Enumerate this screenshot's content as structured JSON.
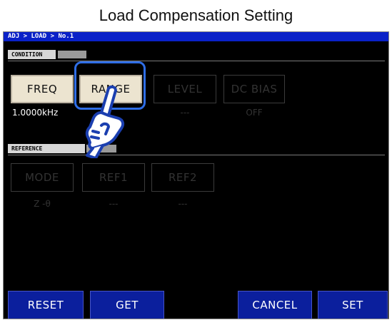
{
  "title": "Load Compensation Setting",
  "breadcrumb": "ADJ > LOAD > No.1",
  "condition": {
    "section_label": "CONDITION",
    "buttons": [
      {
        "label": "FREQ",
        "value": "1.0000kHz",
        "enabled": true
      },
      {
        "label": "RANGE",
        "value": "",
        "enabled": true,
        "highlighted": true
      },
      {
        "label": "LEVEL",
        "value": "---",
        "enabled": false
      },
      {
        "label": "DC BIAS",
        "value": "OFF",
        "enabled": false
      }
    ]
  },
  "reference": {
    "section_label": "REFERENCE",
    "buttons": [
      {
        "label": "MODE",
        "value": "Z -θ",
        "enabled": false
      },
      {
        "label": "REF1",
        "value": "---",
        "enabled": false
      },
      {
        "label": "REF2",
        "value": "---",
        "enabled": false
      }
    ]
  },
  "footer": {
    "reset_label": "RESET",
    "get_label": "GET",
    "cancel_label": "CANCEL",
    "set_label": "SET"
  },
  "colors": {
    "breadcrumb_bg": "#0a21c8",
    "footer_button_bg": "#0b1f9d",
    "active_button_bg": "#ece4d0",
    "highlight": "#2f6ee6"
  },
  "icons": {
    "pointer": "pointing-hand-icon"
  }
}
